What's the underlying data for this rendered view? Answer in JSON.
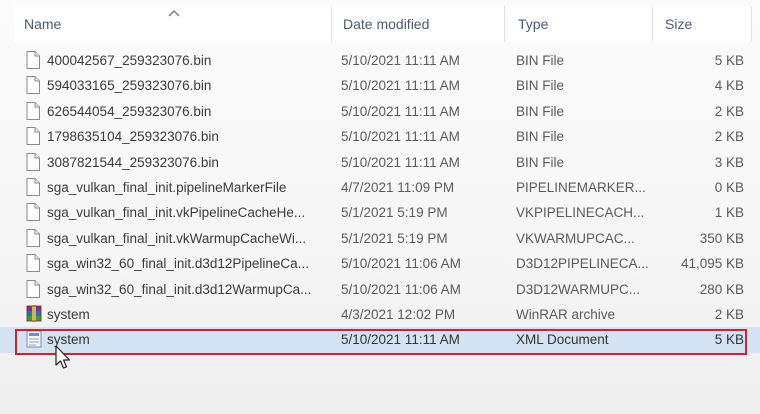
{
  "columns": {
    "name": "Name",
    "date_modified": "Date modified",
    "type": "Type",
    "size": "Size"
  },
  "sort": {
    "column": "name",
    "direction": "ascending",
    "icon": "chevron-up-icon"
  },
  "files": [
    {
      "name": "400042567_259323076.bin",
      "date": "5/10/2021 11:11 AM",
      "type": "BIN File",
      "size": "5 KB",
      "icon": "file-icon"
    },
    {
      "name": "594033165_259323076.bin",
      "date": "5/10/2021 11:11 AM",
      "type": "BIN File",
      "size": "4 KB",
      "icon": "file-icon"
    },
    {
      "name": "626544054_259323076.bin",
      "date": "5/10/2021 11:11 AM",
      "type": "BIN File",
      "size": "2 KB",
      "icon": "file-icon"
    },
    {
      "name": "1798635104_259323076.bin",
      "date": "5/10/2021 11:11 AM",
      "type": "BIN File",
      "size": "2 KB",
      "icon": "file-icon"
    },
    {
      "name": "3087821544_259323076.bin",
      "date": "5/10/2021 11:11 AM",
      "type": "BIN File",
      "size": "3 KB",
      "icon": "file-icon"
    },
    {
      "name": "sga_vulkan_final_init.pipelineMarkerFile",
      "date": "4/7/2021 11:09 PM",
      "type": "PIPELINEMARKER...",
      "size": "0 KB",
      "icon": "file-icon"
    },
    {
      "name": "sga_vulkan_final_init.vkPipelineCacheHe...",
      "date": "5/1/2021 5:19 PM",
      "type": "VKPIPELINECACH...",
      "size": "1 KB",
      "icon": "file-icon"
    },
    {
      "name": "sga_vulkan_final_init.vkWarmupCacheWi...",
      "date": "5/1/2021 5:19 PM",
      "type": "VKWARMUPCAC...",
      "size": "350 KB",
      "icon": "file-icon"
    },
    {
      "name": "sga_win32_60_final_init.d3d12PipelineCa...",
      "date": "5/10/2021 11:06 AM",
      "type": "D3D12PIPELINECA...",
      "size": "41,095 KB",
      "icon": "file-icon"
    },
    {
      "name": "sga_win32_60_final_init.d3d12WarmupCa...",
      "date": "5/10/2021 11:06 AM",
      "type": "D3D12WARMUPC...",
      "size": "280 KB",
      "icon": "file-icon"
    },
    {
      "name": "system",
      "date": "4/3/2021 12:02 PM",
      "type": "WinRAR archive",
      "size": "2 KB",
      "icon": "winrar-archive-icon"
    },
    {
      "name": "system",
      "date": "5/10/2021 11:11 AM",
      "type": "XML Document",
      "size": "5 KB",
      "icon": "xml-document-icon",
      "selected": true
    }
  ],
  "colors": {
    "selection": "#d3e3f3",
    "highlight_border": "#d4212a",
    "header_text": "#4a5a78"
  }
}
